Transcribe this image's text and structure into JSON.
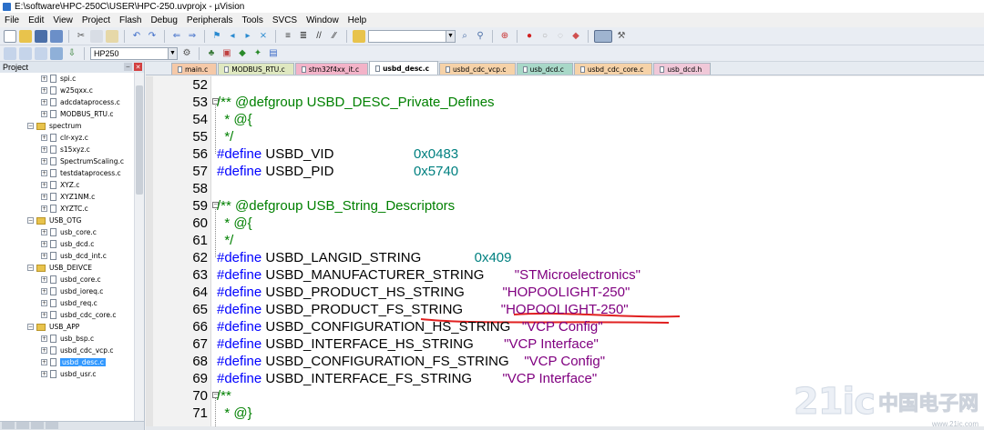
{
  "window": {
    "title": "E:\\software\\HPC-250C\\USER\\HPC-250.uvprojx - µVision"
  },
  "menu": [
    "File",
    "Edit",
    "View",
    "Project",
    "Flash",
    "Debug",
    "Peripherals",
    "Tools",
    "SVCS",
    "Window",
    "Help"
  ],
  "toolbar": {
    "target_select": "HP250",
    "find_combo": ""
  },
  "project": {
    "header": "Project",
    "tree": [
      {
        "label": "spi.c",
        "kind": "file",
        "level": 2
      },
      {
        "label": "w25qxx.c",
        "kind": "file",
        "level": 2
      },
      {
        "label": "adcdataprocess.c",
        "kind": "file",
        "level": 2
      },
      {
        "label": "MODBUS_RTU.c",
        "kind": "file",
        "level": 2
      },
      {
        "label": "spectrum",
        "kind": "folder",
        "level": 1
      },
      {
        "label": "clr-xyz.c",
        "kind": "file",
        "level": 2
      },
      {
        "label": "s15xyz.c",
        "kind": "file",
        "level": 2
      },
      {
        "label": "SpectrumScaling.c",
        "kind": "file",
        "level": 2
      },
      {
        "label": "testdataprocess.c",
        "kind": "file",
        "level": 2
      },
      {
        "label": "XYZ.c",
        "kind": "file",
        "level": 2
      },
      {
        "label": "XYZ1NM.c",
        "kind": "file",
        "level": 2
      },
      {
        "label": "XYZTC.c",
        "kind": "file",
        "level": 2
      },
      {
        "label": "USB_OTG",
        "kind": "folder",
        "level": 1
      },
      {
        "label": "usb_core.c",
        "kind": "file",
        "level": 2
      },
      {
        "label": "usb_dcd.c",
        "kind": "file",
        "level": 2
      },
      {
        "label": "usb_dcd_int.c",
        "kind": "file",
        "level": 2
      },
      {
        "label": "USB_DEIVCE",
        "kind": "folder",
        "level": 1
      },
      {
        "label": "usbd_core.c",
        "kind": "file",
        "level": 2
      },
      {
        "label": "usbd_ioreq.c",
        "kind": "file",
        "level": 2
      },
      {
        "label": "usbd_req.c",
        "kind": "file",
        "level": 2
      },
      {
        "label": "usbd_cdc_core.c",
        "kind": "file",
        "level": 2
      },
      {
        "label": "USB_APP",
        "kind": "folder",
        "level": 1
      },
      {
        "label": "usb_bsp.c",
        "kind": "file",
        "level": 2
      },
      {
        "label": "usbd_cdc_vcp.c",
        "kind": "file",
        "level": 2
      },
      {
        "label": "usbd_desc.c",
        "kind": "file",
        "level": 2,
        "selected": true
      },
      {
        "label": "usbd_usr.c",
        "kind": "file",
        "level": 2
      }
    ]
  },
  "tabs": [
    {
      "label": "main.c",
      "color": "#f5c9a8"
    },
    {
      "label": "MODBUS_RTU.c",
      "color": "#dfe8c0"
    },
    {
      "label": "stm32f4xx_it.c",
      "color": "#f3b3c8"
    },
    {
      "label": "usbd_desc.c",
      "color": "#ffffff",
      "active": true
    },
    {
      "label": "usbd_cdc_vcp.c",
      "color": "#f6d2a8"
    },
    {
      "label": "usb_dcd.c",
      "color": "#a8d8c8"
    },
    {
      "label": "usbd_cdc_core.c",
      "color": "#f6d2a8"
    },
    {
      "label": "usb_dcd.h",
      "color": "#f0c8d8"
    }
  ],
  "code": [
    {
      "n": "52",
      "parts": []
    },
    {
      "n": "53",
      "parts": [
        {
          "c": "cm",
          "t": "/** @defgroup USBD_DESC_Private_Defines"
        }
      ]
    },
    {
      "n": "54",
      "parts": [
        {
          "c": "cm",
          "t": "  * @{"
        }
      ]
    },
    {
      "n": "55",
      "parts": [
        {
          "c": "cm",
          "t": "  */"
        }
      ]
    },
    {
      "n": "56",
      "parts": [
        {
          "c": "kw",
          "t": "#define"
        },
        {
          "c": "pl",
          "t": " USBD_VID                     "
        },
        {
          "c": "hx",
          "t": "0x0483"
        }
      ]
    },
    {
      "n": "57",
      "parts": [
        {
          "c": "kw",
          "t": "#define"
        },
        {
          "c": "pl",
          "t": " USBD_PID                     "
        },
        {
          "c": "hx",
          "t": "0x5740"
        }
      ]
    },
    {
      "n": "58",
      "parts": []
    },
    {
      "n": "59",
      "parts": [
        {
          "c": "cm",
          "t": "/** @defgroup USB_String_Descriptors"
        }
      ]
    },
    {
      "n": "60",
      "parts": [
        {
          "c": "cm",
          "t": "  * @{"
        }
      ]
    },
    {
      "n": "61",
      "parts": [
        {
          "c": "cm",
          "t": "  */"
        }
      ]
    },
    {
      "n": "62",
      "parts": [
        {
          "c": "kw",
          "t": "#define"
        },
        {
          "c": "pl",
          "t": " USBD_LANGID_STRING              "
        },
        {
          "c": "hx",
          "t": "0x409"
        }
      ]
    },
    {
      "n": "63",
      "parts": [
        {
          "c": "kw",
          "t": "#define"
        },
        {
          "c": "pl",
          "t": " USBD_MANUFACTURER_STRING        "
        },
        {
          "c": "st",
          "t": "\"STMicroelectronics\""
        }
      ]
    },
    {
      "n": "64",
      "parts": [
        {
          "c": "kw",
          "t": "#define"
        },
        {
          "c": "pl",
          "t": " USBD_PRODUCT_HS_STRING          "
        },
        {
          "c": "st",
          "t": "\"HOPOOLIGHT-250\""
        }
      ]
    },
    {
      "n": "65",
      "parts": [
        {
          "c": "kw",
          "t": "#define"
        },
        {
          "c": "pl",
          "t": " USBD_PRODUCT_FS_STRING          "
        },
        {
          "c": "st",
          "t": "\"HOPOOLIGHT-250\""
        }
      ]
    },
    {
      "n": "66",
      "parts": [
        {
          "c": "kw",
          "t": "#define"
        },
        {
          "c": "pl",
          "t": " USBD_CONFIGURATION_HS_STRING   "
        },
        {
          "c": "st",
          "t": "\"VCP Config\""
        }
      ]
    },
    {
      "n": "67",
      "parts": [
        {
          "c": "kw",
          "t": "#define"
        },
        {
          "c": "pl",
          "t": " USBD_INTERFACE_HS_STRING        "
        },
        {
          "c": "st",
          "t": "\"VCP Interface\""
        }
      ]
    },
    {
      "n": "68",
      "parts": [
        {
          "c": "kw",
          "t": "#define"
        },
        {
          "c": "pl",
          "t": " USBD_CONFIGURATION_FS_STRING    "
        },
        {
          "c": "st",
          "t": "\"VCP Config\""
        }
      ]
    },
    {
      "n": "69",
      "parts": [
        {
          "c": "kw",
          "t": "#define"
        },
        {
          "c": "pl",
          "t": " USBD_INTERFACE_FS_STRING        "
        },
        {
          "c": "st",
          "t": "\"VCP Interface\""
        }
      ]
    },
    {
      "n": "70",
      "parts": [
        {
          "c": "cm",
          "t": "/**"
        }
      ]
    },
    {
      "n": "71",
      "parts": [
        {
          "c": "cm",
          "t": "  * @}"
        }
      ]
    }
  ],
  "watermark": {
    "big": "21ic",
    "cn": "中国电子网",
    "url": "www.21ic.com"
  },
  "colors": {
    "comment": "#008000",
    "keyword": "#0000ff",
    "hex": "#008080",
    "string": "#800080",
    "annotation": "#e02020"
  }
}
